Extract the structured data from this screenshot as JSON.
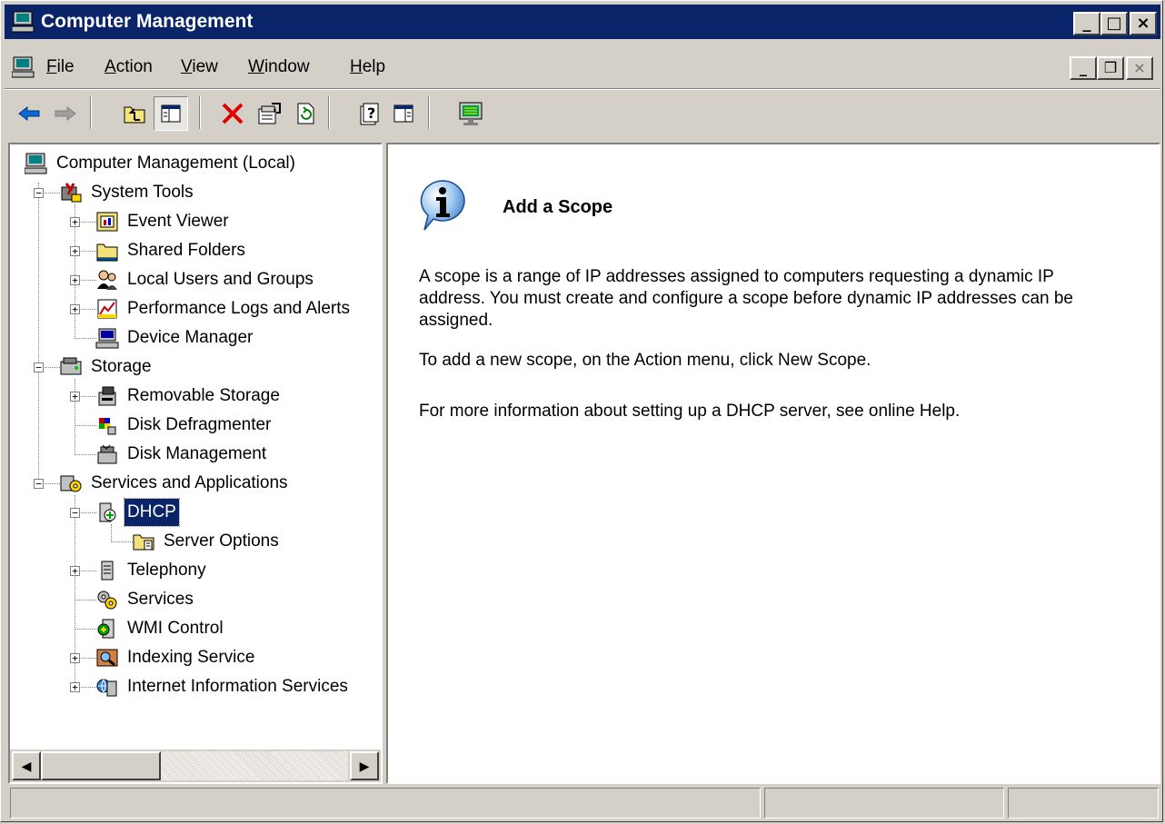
{
  "window": {
    "title": "Computer Management",
    "caption_buttons": [
      "minimize",
      "maximize",
      "close"
    ]
  },
  "menubar": {
    "items": [
      {
        "label": "File",
        "accel": "F",
        "rest": "ile"
      },
      {
        "label": "Action",
        "accel": "A",
        "rest": "ction"
      },
      {
        "label": "View",
        "accel": "V",
        "rest": "iew"
      },
      {
        "label": "Window",
        "accel": "W",
        "rest": "indow"
      },
      {
        "label": "Help",
        "accel": "H",
        "rest": "elp"
      }
    ],
    "mdi_buttons": [
      "minimize",
      "restore",
      "close"
    ]
  },
  "toolbar": {
    "buttons": [
      "back-icon",
      "forward-icon",
      "up-one-level-icon",
      "show-hide-console-tree-icon",
      "delete-icon",
      "properties-icon",
      "refresh-icon",
      "help-icon",
      "show-hide-action-pane-icon",
      "server-monitor-icon"
    ]
  },
  "tree": {
    "nodes": [
      {
        "label": "Computer Management (Local)",
        "icon": "computer-icon",
        "level": 0
      },
      {
        "label": "System Tools",
        "icon": "system-tools-icon",
        "level": 1,
        "expander": "minus"
      },
      {
        "label": "Event Viewer",
        "icon": "event-viewer-icon",
        "level": 2,
        "expander": "plus"
      },
      {
        "label": "Shared Folders",
        "icon": "shared-folder-icon",
        "level": 2,
        "expander": "plus"
      },
      {
        "label": "Local Users and Groups",
        "icon": "users-icon",
        "level": 2,
        "expander": "plus"
      },
      {
        "label": "Performance Logs and Alerts",
        "icon": "performance-icon",
        "level": 2,
        "expander": "plus"
      },
      {
        "label": "Device Manager",
        "icon": "device-manager-icon",
        "level": 2,
        "expander": "none"
      },
      {
        "label": "Storage",
        "icon": "storage-icon",
        "level": 1,
        "expander": "minus"
      },
      {
        "label": "Removable Storage",
        "icon": "removable-storage-icon",
        "level": 2,
        "expander": "plus"
      },
      {
        "label": "Disk Defragmenter",
        "icon": "defrag-icon",
        "level": 2,
        "expander": "none"
      },
      {
        "label": "Disk Management",
        "icon": "disk-management-icon",
        "level": 2,
        "expander": "none"
      },
      {
        "label": "Services and Applications",
        "icon": "services-apps-icon",
        "level": 1,
        "expander": "minus"
      },
      {
        "label": "DHCP",
        "icon": "dhcp-icon",
        "level": 2,
        "expander": "minus",
        "selected": true
      },
      {
        "label": "Server Options",
        "icon": "server-options-icon",
        "level": 3,
        "expander": "none"
      },
      {
        "label": "Telephony",
        "icon": "telephony-icon",
        "level": 2,
        "expander": "plus"
      },
      {
        "label": "Services",
        "icon": "services-icon",
        "level": 2,
        "expander": "none"
      },
      {
        "label": "WMI Control",
        "icon": "wmi-icon",
        "level": 2,
        "expander": "none"
      },
      {
        "label": "Indexing Service",
        "icon": "indexing-icon",
        "level": 2,
        "expander": "plus"
      },
      {
        "label": "Internet Information Services",
        "icon": "iis-icon",
        "level": 2,
        "expander": "plus"
      }
    ]
  },
  "content": {
    "icon": "info-icon",
    "heading": "Add a Scope",
    "paragraph1": "A scope is a range of IP addresses assigned to computers requesting a dynamic IP address. You must create and configure a scope before dynamic IP addresses can be assigned.",
    "paragraph2": "To add a new scope, on the Action menu, click New Scope.",
    "paragraph3": "For more information about setting up a DHCP server, see online Help."
  },
  "statusbar": {
    "panels": [
      "",
      "",
      ""
    ]
  }
}
